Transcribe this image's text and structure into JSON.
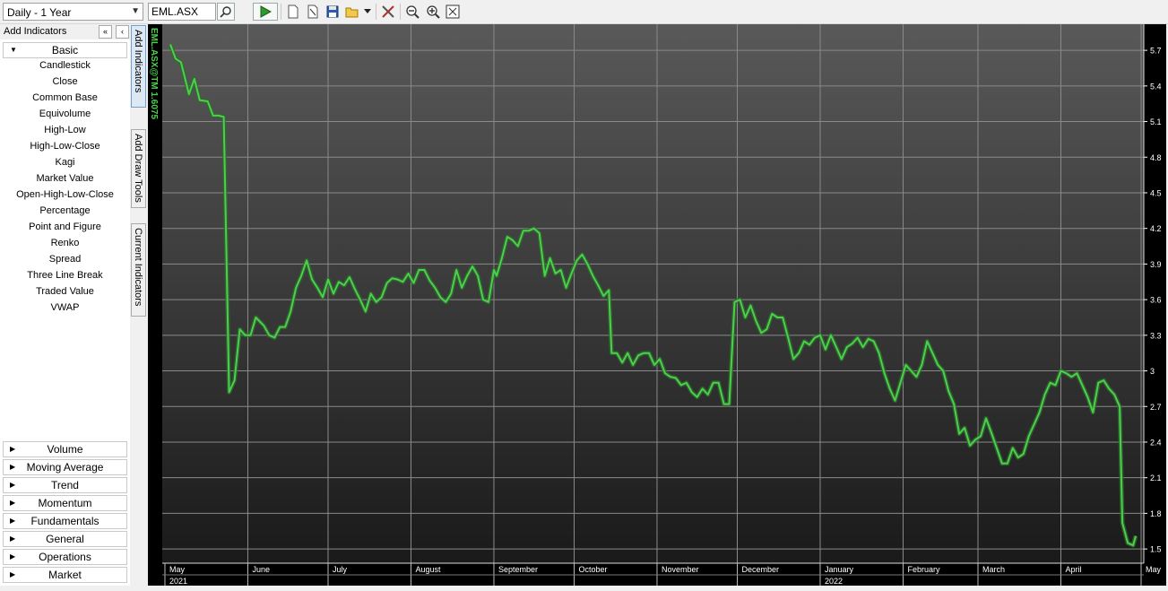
{
  "toolbar": {
    "period_value": "Daily - 1 Year",
    "symbol_value": "EML.ASX",
    "icons": [
      "search-icon",
      "play-icon",
      "new-chart-icon",
      "edit-icon",
      "save-icon",
      "open-folder-icon",
      "dropdown-arrow-icon",
      "tools-icon",
      "zoom-out-icon",
      "zoom-in-icon",
      "zoom-fit-icon"
    ]
  },
  "left_panel": {
    "title": "Add Indicators",
    "collapse_all": "«",
    "collapse": "‹",
    "basic_label": "Basic",
    "basic_items": [
      "Candlestick",
      "Close",
      "Common Base",
      "Equivolume",
      "High-Low",
      "High-Low-Close",
      "Kagi",
      "Market Value",
      "Open-High-Low-Close",
      "Percentage",
      "Point and Figure",
      "Renko",
      "Spread",
      "Three Line Break",
      "Traded Value",
      "VWAP"
    ],
    "groups": [
      "Volume",
      "Moving Average",
      "Trend",
      "Momentum",
      "Fundamentals",
      "General",
      "Operations",
      "Market"
    ]
  },
  "vertical_tabs": [
    "Add Indicators",
    "Add Draw Tools",
    "Current Indicators"
  ],
  "colors": {
    "line": "#4cd04c",
    "chart_bg_top": "#555555",
    "chart_bg_bottom": "#1c1c1c"
  },
  "chart_data": {
    "type": "line",
    "series_label": "EML.ASX@TM 1.6075",
    "ylim": [
      1.38,
      5.92
    ],
    "yticks": [
      5.7,
      5.4,
      5.1,
      4.8,
      4.5,
      4.2,
      3.9,
      3.6,
      3.3,
      3,
      2.7,
      2.4,
      2.1,
      1.8,
      1.5
    ],
    "ytick_labels": [
      "5.7",
      "5.4",
      "5.1",
      "4.8",
      "4.5",
      "4.2",
      "3.9",
      "3.6",
      "3.3",
      "3",
      "2.7",
      "2.4",
      "2.1",
      "1.8",
      "1.5"
    ],
    "xlim": [
      "2021-04-30",
      "2022-05-02"
    ],
    "month_labels": [
      {
        "date": "2021-05-01",
        "label": "May"
      },
      {
        "date": "2021-06-01",
        "label": "June"
      },
      {
        "date": "2021-07-01",
        "label": "July"
      },
      {
        "date": "2021-08-01",
        "label": "August"
      },
      {
        "date": "2021-09-01",
        "label": "September"
      },
      {
        "date": "2021-10-01",
        "label": "October"
      },
      {
        "date": "2021-11-01",
        "label": "November"
      },
      {
        "date": "2021-12-01",
        "label": "December"
      },
      {
        "date": "2022-01-01",
        "label": "January"
      },
      {
        "date": "2022-02-01",
        "label": "February"
      },
      {
        "date": "2022-03-01",
        "label": "March"
      },
      {
        "date": "2022-04-01",
        "label": "April"
      },
      {
        "date": "2022-05-01",
        "label": "May"
      }
    ],
    "year_labels": [
      {
        "date": "2021-05-01",
        "label": "2021"
      },
      {
        "date": "2022-01-01",
        "label": "2022"
      }
    ],
    "vgrid_dates": [
      "2021-06-01",
      "2021-07-01",
      "2021-08-01",
      "2021-09-01",
      "2021-10-01",
      "2021-11-01",
      "2021-12-01",
      "2022-01-01",
      "2022-02-01",
      "2022-03-01",
      "2022-04-01",
      "2022-05-01"
    ],
    "grid": true,
    "points": [
      [
        "2021-05-03",
        5.75
      ],
      [
        "2021-05-05",
        5.63
      ],
      [
        "2021-05-07",
        5.6
      ],
      [
        "2021-05-10",
        5.33
      ],
      [
        "2021-05-12",
        5.46
      ],
      [
        "2021-05-14",
        5.28
      ],
      [
        "2021-05-17",
        5.27
      ],
      [
        "2021-05-19",
        5.15
      ],
      [
        "2021-05-21",
        5.15
      ],
      [
        "2021-05-23",
        5.14
      ],
      [
        "2021-05-25",
        2.82
      ],
      [
        "2021-05-27",
        2.92
      ],
      [
        "2021-05-29",
        3.35
      ],
      [
        "2021-05-31",
        3.3
      ],
      [
        "2021-06-02",
        3.3
      ],
      [
        "2021-06-04",
        3.45
      ],
      [
        "2021-06-07",
        3.38
      ],
      [
        "2021-06-09",
        3.3
      ],
      [
        "2021-06-11",
        3.28
      ],
      [
        "2021-06-13",
        3.37
      ],
      [
        "2021-06-15",
        3.37
      ],
      [
        "2021-06-17",
        3.5
      ],
      [
        "2021-06-19",
        3.7
      ],
      [
        "2021-06-21",
        3.8
      ],
      [
        "2021-06-23",
        3.93
      ],
      [
        "2021-06-25",
        3.77
      ],
      [
        "2021-06-27",
        3.7
      ],
      [
        "2021-06-29",
        3.62
      ],
      [
        "2021-07-01",
        3.77
      ],
      [
        "2021-07-03",
        3.65
      ],
      [
        "2021-07-05",
        3.75
      ],
      [
        "2021-07-07",
        3.72
      ],
      [
        "2021-07-09",
        3.79
      ],
      [
        "2021-07-11",
        3.69
      ],
      [
        "2021-07-13",
        3.6
      ],
      [
        "2021-07-15",
        3.5
      ],
      [
        "2021-07-17",
        3.65
      ],
      [
        "2021-07-19",
        3.58
      ],
      [
        "2021-07-21",
        3.62
      ],
      [
        "2021-07-23",
        3.74
      ],
      [
        "2021-07-25",
        3.78
      ],
      [
        "2021-07-27",
        3.77
      ],
      [
        "2021-07-29",
        3.75
      ],
      [
        "2021-07-31",
        3.82
      ],
      [
        "2021-08-02",
        3.74
      ],
      [
        "2021-08-04",
        3.85
      ],
      [
        "2021-08-06",
        3.85
      ],
      [
        "2021-08-08",
        3.76
      ],
      [
        "2021-08-10",
        3.7
      ],
      [
        "2021-08-12",
        3.62
      ],
      [
        "2021-08-14",
        3.58
      ],
      [
        "2021-08-16",
        3.65
      ],
      [
        "2021-08-18",
        3.85
      ],
      [
        "2021-08-20",
        3.7
      ],
      [
        "2021-08-22",
        3.8
      ],
      [
        "2021-08-24",
        3.88
      ],
      [
        "2021-08-26",
        3.8
      ],
      [
        "2021-08-28",
        3.6
      ],
      [
        "2021-08-30",
        3.58
      ],
      [
        "2021-09-01",
        3.85
      ],
      [
        "2021-09-02",
        3.8
      ],
      [
        "2021-09-04",
        3.95
      ],
      [
        "2021-09-06",
        4.13
      ],
      [
        "2021-09-08",
        4.1
      ],
      [
        "2021-09-10",
        4.05
      ],
      [
        "2021-09-12",
        4.18
      ],
      [
        "2021-09-14",
        4.18
      ],
      [
        "2021-09-16",
        4.2
      ],
      [
        "2021-09-18",
        4.16
      ],
      [
        "2021-09-20",
        3.8
      ],
      [
        "2021-09-22",
        3.95
      ],
      [
        "2021-09-24",
        3.82
      ],
      [
        "2021-09-26",
        3.85
      ],
      [
        "2021-09-28",
        3.7
      ],
      [
        "2021-09-30",
        3.82
      ],
      [
        "2021-10-02",
        3.93
      ],
      [
        "2021-10-04",
        3.98
      ],
      [
        "2021-10-06",
        3.9
      ],
      [
        "2021-10-08",
        3.8
      ],
      [
        "2021-10-10",
        3.72
      ],
      [
        "2021-10-12",
        3.63
      ],
      [
        "2021-10-14",
        3.68
      ],
      [
        "2021-10-15",
        3.15
      ],
      [
        "2021-10-17",
        3.15
      ],
      [
        "2021-10-19",
        3.07
      ],
      [
        "2021-10-21",
        3.15
      ],
      [
        "2021-10-23",
        3.05
      ],
      [
        "2021-10-25",
        3.13
      ],
      [
        "2021-10-27",
        3.15
      ],
      [
        "2021-10-29",
        3.15
      ],
      [
        "2021-10-31",
        3.05
      ],
      [
        "2021-11-02",
        3.1
      ],
      [
        "2021-11-04",
        2.98
      ],
      [
        "2021-11-06",
        2.95
      ],
      [
        "2021-11-08",
        2.94
      ],
      [
        "2021-11-10",
        2.88
      ],
      [
        "2021-11-12",
        2.9
      ],
      [
        "2021-11-14",
        2.82
      ],
      [
        "2021-11-16",
        2.78
      ],
      [
        "2021-11-18",
        2.85
      ],
      [
        "2021-11-20",
        2.8
      ],
      [
        "2021-11-22",
        2.9
      ],
      [
        "2021-11-24",
        2.9
      ],
      [
        "2021-11-26",
        2.72
      ],
      [
        "2021-11-28",
        2.72
      ],
      [
        "2021-11-30",
        3.58
      ],
      [
        "2021-12-02",
        3.6
      ],
      [
        "2021-12-04",
        3.45
      ],
      [
        "2021-12-06",
        3.55
      ],
      [
        "2021-12-08",
        3.42
      ],
      [
        "2021-12-10",
        3.32
      ],
      [
        "2021-12-12",
        3.35
      ],
      [
        "2021-12-14",
        3.48
      ],
      [
        "2021-12-16",
        3.45
      ],
      [
        "2021-12-18",
        3.45
      ],
      [
        "2021-12-20",
        3.28
      ],
      [
        "2021-12-22",
        3.1
      ],
      [
        "2021-12-24",
        3.15
      ],
      [
        "2021-12-26",
        3.25
      ],
      [
        "2021-12-28",
        3.22
      ],
      [
        "2021-12-30",
        3.28
      ],
      [
        "2022-01-01",
        3.3
      ],
      [
        "2022-01-03",
        3.18
      ],
      [
        "2022-01-05",
        3.3
      ],
      [
        "2022-01-07",
        3.2
      ],
      [
        "2022-01-09",
        3.1
      ],
      [
        "2022-01-11",
        3.2
      ],
      [
        "2022-01-13",
        3.23
      ],
      [
        "2022-01-15",
        3.28
      ],
      [
        "2022-01-17",
        3.2
      ],
      [
        "2022-01-19",
        3.27
      ],
      [
        "2022-01-21",
        3.25
      ],
      [
        "2022-01-23",
        3.15
      ],
      [
        "2022-01-25",
        2.98
      ],
      [
        "2022-01-27",
        2.85
      ],
      [
        "2022-01-29",
        2.75
      ],
      [
        "2022-01-31",
        2.9
      ],
      [
        "2022-02-02",
        3.05
      ],
      [
        "2022-02-04",
        3.0
      ],
      [
        "2022-02-06",
        2.95
      ],
      [
        "2022-02-08",
        3.05
      ],
      [
        "2022-02-10",
        3.25
      ],
      [
        "2022-02-12",
        3.15
      ],
      [
        "2022-02-14",
        3.05
      ],
      [
        "2022-02-16",
        3.0
      ],
      [
        "2022-02-18",
        2.83
      ],
      [
        "2022-02-20",
        2.72
      ],
      [
        "2022-02-22",
        2.47
      ],
      [
        "2022-02-24",
        2.52
      ],
      [
        "2022-02-26",
        2.37
      ],
      [
        "2022-02-28",
        2.42
      ],
      [
        "2022-03-02",
        2.45
      ],
      [
        "2022-03-04",
        2.6
      ],
      [
        "2022-03-06",
        2.48
      ],
      [
        "2022-03-08",
        2.35
      ],
      [
        "2022-03-10",
        2.22
      ],
      [
        "2022-03-12",
        2.22
      ],
      [
        "2022-03-14",
        2.35
      ],
      [
        "2022-03-16",
        2.27
      ],
      [
        "2022-03-18",
        2.3
      ],
      [
        "2022-03-20",
        2.45
      ],
      [
        "2022-03-22",
        2.55
      ],
      [
        "2022-03-24",
        2.65
      ],
      [
        "2022-03-26",
        2.8
      ],
      [
        "2022-03-28",
        2.9
      ],
      [
        "2022-03-30",
        2.88
      ],
      [
        "2022-04-01",
        3.0
      ],
      [
        "2022-04-03",
        2.98
      ],
      [
        "2022-04-05",
        2.95
      ],
      [
        "2022-04-07",
        2.98
      ],
      [
        "2022-04-09",
        2.88
      ],
      [
        "2022-04-11",
        2.78
      ],
      [
        "2022-04-13",
        2.65
      ],
      [
        "2022-04-15",
        2.9
      ],
      [
        "2022-04-17",
        2.92
      ],
      [
        "2022-04-19",
        2.85
      ],
      [
        "2022-04-21",
        2.8
      ],
      [
        "2022-04-23",
        2.7
      ],
      [
        "2022-04-24",
        1.72
      ],
      [
        "2022-04-26",
        1.55
      ],
      [
        "2022-04-28",
        1.53
      ],
      [
        "2022-04-29",
        1.61
      ]
    ]
  }
}
